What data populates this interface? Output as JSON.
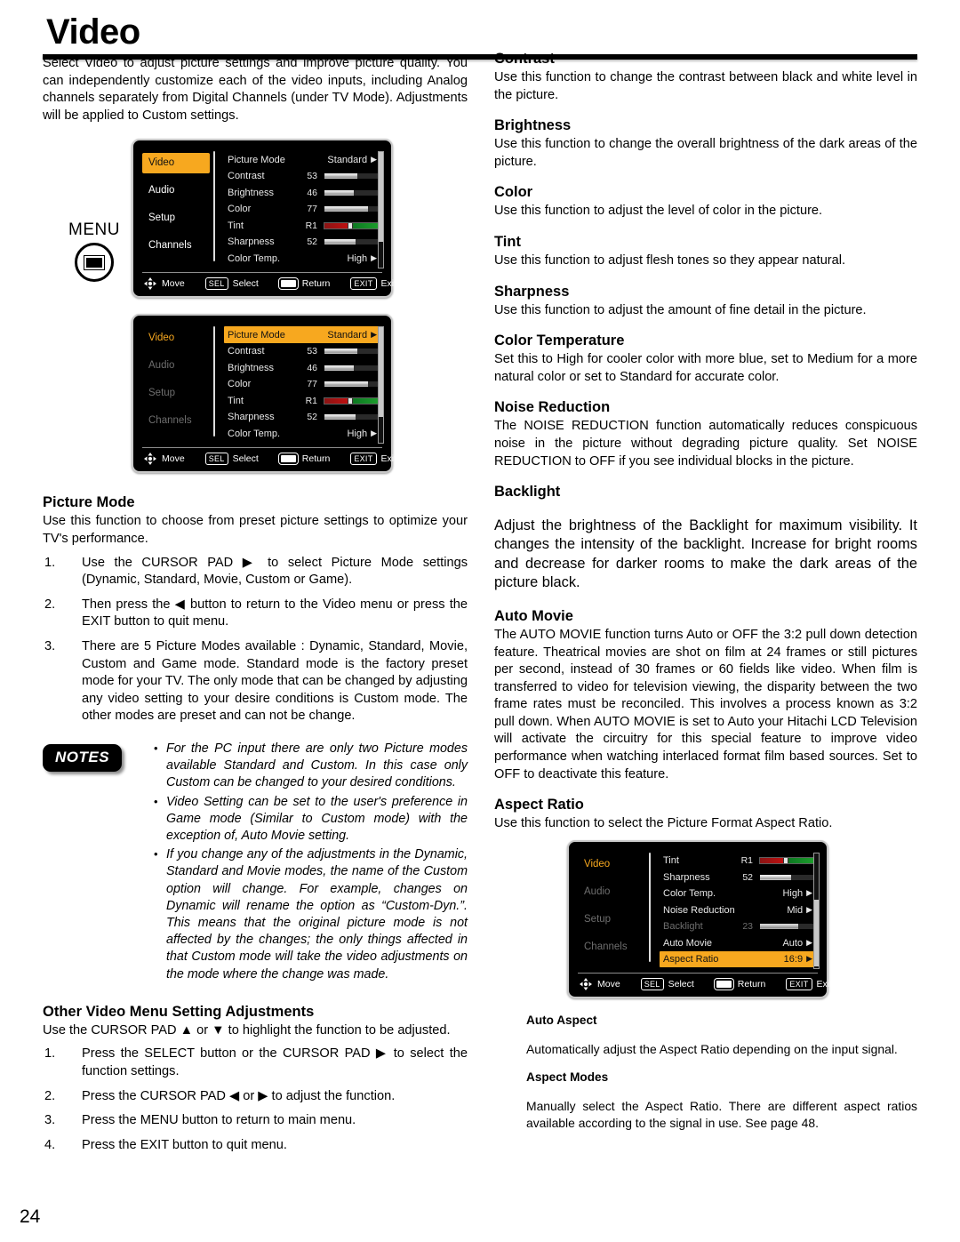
{
  "header": {
    "title": "Video"
  },
  "intro": "Select Video to adjust picture settings and improve picture quality. You can independently customize each of the video inputs, including Analog channels separately from Digital Channels (under TV Mode). Adjustments will be applied to Custom settings.",
  "menu_button": {
    "label": "MENU",
    "icon": "menu-rect-icon"
  },
  "osd_footer": {
    "move": "Move",
    "sel_key": "SEL",
    "select": "Select",
    "return": "Return",
    "exit_key": "EXIT",
    "exit": "Exit"
  },
  "osd_tabs": [
    "Video",
    "Audio",
    "Setup",
    "Channels"
  ],
  "osd_menu_1": {
    "active_tab": "Video",
    "rows": [
      {
        "label": "Picture Mode",
        "value": "Standard",
        "type": "arrow"
      },
      {
        "label": "Contrast",
        "value": "53",
        "type": "bar",
        "fill": 62
      },
      {
        "label": "Brightness",
        "value": "46",
        "type": "bar",
        "fill": 55
      },
      {
        "label": "Color",
        "value": "77",
        "type": "bar",
        "fill": 82
      },
      {
        "label": "Tint",
        "value": "R1",
        "type": "tint",
        "fill": 45
      },
      {
        "label": "Sharpness",
        "value": "52",
        "type": "bar",
        "fill": 58
      },
      {
        "label": "Color Temp.",
        "value": "High",
        "type": "arrow"
      }
    ]
  },
  "osd_menu_2": {
    "active_tab": "Video",
    "highlight_row": "Picture Mode",
    "rows": [
      {
        "label": "Picture Mode",
        "value": "Standard",
        "type": "arrow"
      },
      {
        "label": "Contrast",
        "value": "53",
        "type": "bar",
        "fill": 62
      },
      {
        "label": "Brightness",
        "value": "46",
        "type": "bar",
        "fill": 55
      },
      {
        "label": "Color",
        "value": "77",
        "type": "bar",
        "fill": 82
      },
      {
        "label": "Tint",
        "value": "R1",
        "type": "tint",
        "fill": 45
      },
      {
        "label": "Sharpness",
        "value": "52",
        "type": "bar",
        "fill": 58
      },
      {
        "label": "Color Temp.",
        "value": "High",
        "type": "arrow"
      }
    ]
  },
  "osd_menu_3": {
    "active_tab": "Video",
    "highlight_row": "Aspect Ratio",
    "rows": [
      {
        "label": "Tint",
        "value": "R1",
        "type": "tint",
        "fill": 45
      },
      {
        "label": "Sharpness",
        "value": "52",
        "type": "bar",
        "fill": 58
      },
      {
        "label": "Color Temp.",
        "value": "High",
        "type": "arrow"
      },
      {
        "label": "Noise Reduction",
        "value": "Mid",
        "type": "arrow"
      },
      {
        "label": "Backlight",
        "value": "23",
        "type": "bar",
        "fill": 72,
        "dim": true
      },
      {
        "label": "Auto Movie",
        "value": "Auto",
        "type": "arrow"
      },
      {
        "label": "Aspect Ratio",
        "value": "16:9",
        "type": "arrow"
      }
    ]
  },
  "picture_mode": {
    "heading": "Picture Mode",
    "body": "Use this function to choose from preset picture settings to optimize your TV's performance.",
    "steps": [
      {
        "num": "1.",
        "text": "Use the CURSOR PAD ▶ to select Picture Mode settings (Dynamic, Standard, Movie, Custom or Game)."
      },
      {
        "num": "2.",
        "text": "Then press the ◀ button to return to the Video menu or press the EXIT button to quit menu."
      },
      {
        "num": "3.",
        "text": "There are 5 Picture Modes available : Dynamic, Standard, Movie, Custom and Game mode. Standard mode is the factory preset mode for your TV. The only mode that can be changed by adjusting any video setting to your desire conditions is Custom mode. The other modes are preset and can not be change."
      }
    ]
  },
  "notes": {
    "badge": "NOTES",
    "items": [
      "For the PC input there are only two Picture modes available Standard and Custom. In this case only Custom can be changed to your desired conditions.",
      "Video Setting can be set to the user's preference in Game mode (Similar to Custom mode) with the exception of, Auto Movie setting.",
      "If you change any of the adjustments in the Dynamic, Standard and Movie modes, the name of the Custom option will change. For example, changes on Dynamic will rename the option as “Custom-Dyn.”. This means that the original picture mode is not affected by the changes; the only things affected in that Custom mode will take the video adjustments on the mode where the change was made."
    ]
  },
  "other_adjustments": {
    "heading": "Other Video Menu Setting Adjustments",
    "body": "Use the CURSOR PAD ▲ or ▼ to highlight the function to be adjusted.",
    "steps": [
      {
        "num": "1.",
        "text": "Press the SELECT button or the CURSOR PAD ▶ to select the function settings."
      },
      {
        "num": "2.",
        "text": "Press the CURSOR PAD ◀ or ▶ to adjust the function."
      },
      {
        "num": "3.",
        "text": "Press the MENU button to return to main menu."
      },
      {
        "num": "4.",
        "text": "Press the EXIT button to quit menu."
      }
    ]
  },
  "right_sections": [
    {
      "heading": "Contrast",
      "body": "Use this function to change the contrast between black and white level in the picture."
    },
    {
      "heading": "Brightness",
      "body": "Use this function to change the overall brightness of the dark areas of the picture."
    },
    {
      "heading": "Color",
      "body": "Use this function to adjust the level of color in the picture."
    },
    {
      "heading": "Tint",
      "body": "Use this function to adjust flesh tones so they appear natural."
    },
    {
      "heading": "Sharpness",
      "body": "Use this function to adjust the amount of fine detail in the picture."
    },
    {
      "heading": "Color Temperature",
      "body": "Set this to High for cooler color with more blue, set to Medium for a more natural color or set to Standard for accurate color."
    },
    {
      "heading": "Noise Reduction",
      "body": "The NOISE REDUCTION function automatically reduces conspicuous noise in the picture without degrading picture quality. Set NOISE REDUCTION to OFF if you see individual blocks in the picture."
    },
    {
      "heading": "Backlight",
      "body": "Adjust the brightness of the Backlight for maximum visibility. It changes the intensity of the backlight. Increase for bright rooms and decrease for darker rooms to make the dark areas of the picture black."
    },
    {
      "heading": "Auto Movie",
      "body": "The AUTO MOVIE function turns Auto or OFF the 3:2 pull down detection feature. Theatrical movies are shot on film at 24 frames or still pictures per second, instead of 30 frames or 60 fields like video. When film is transferred to video for television viewing, the disparity between the two frame rates must be reconciled. This involves a process known as 3:2 pull down. When AUTO MOVIE is set to Auto your Hitachi LCD Television will activate the circuitry for this special feature to improve video performance when watching interlaced format film based sources. Set to OFF to deactivate this feature."
    },
    {
      "heading": "Aspect Ratio",
      "body": "Use this function to select the Picture Format Aspect Ratio."
    }
  ],
  "aspect_subsections": [
    {
      "heading": "Auto Aspect",
      "body": "Automatically adjust the Aspect Ratio depending on the input signal."
    },
    {
      "heading": "Aspect Modes",
      "body": "Manually select the Aspect Ratio. There are different aspect ratios available according to the signal in use. See page 48."
    }
  ],
  "page_number": "24",
  "colors": {
    "accent": "#f7a81f",
    "osd_bg": "#000000",
    "osd_text": "#e8e8e8",
    "osd_dim": "#6e6e6e"
  }
}
